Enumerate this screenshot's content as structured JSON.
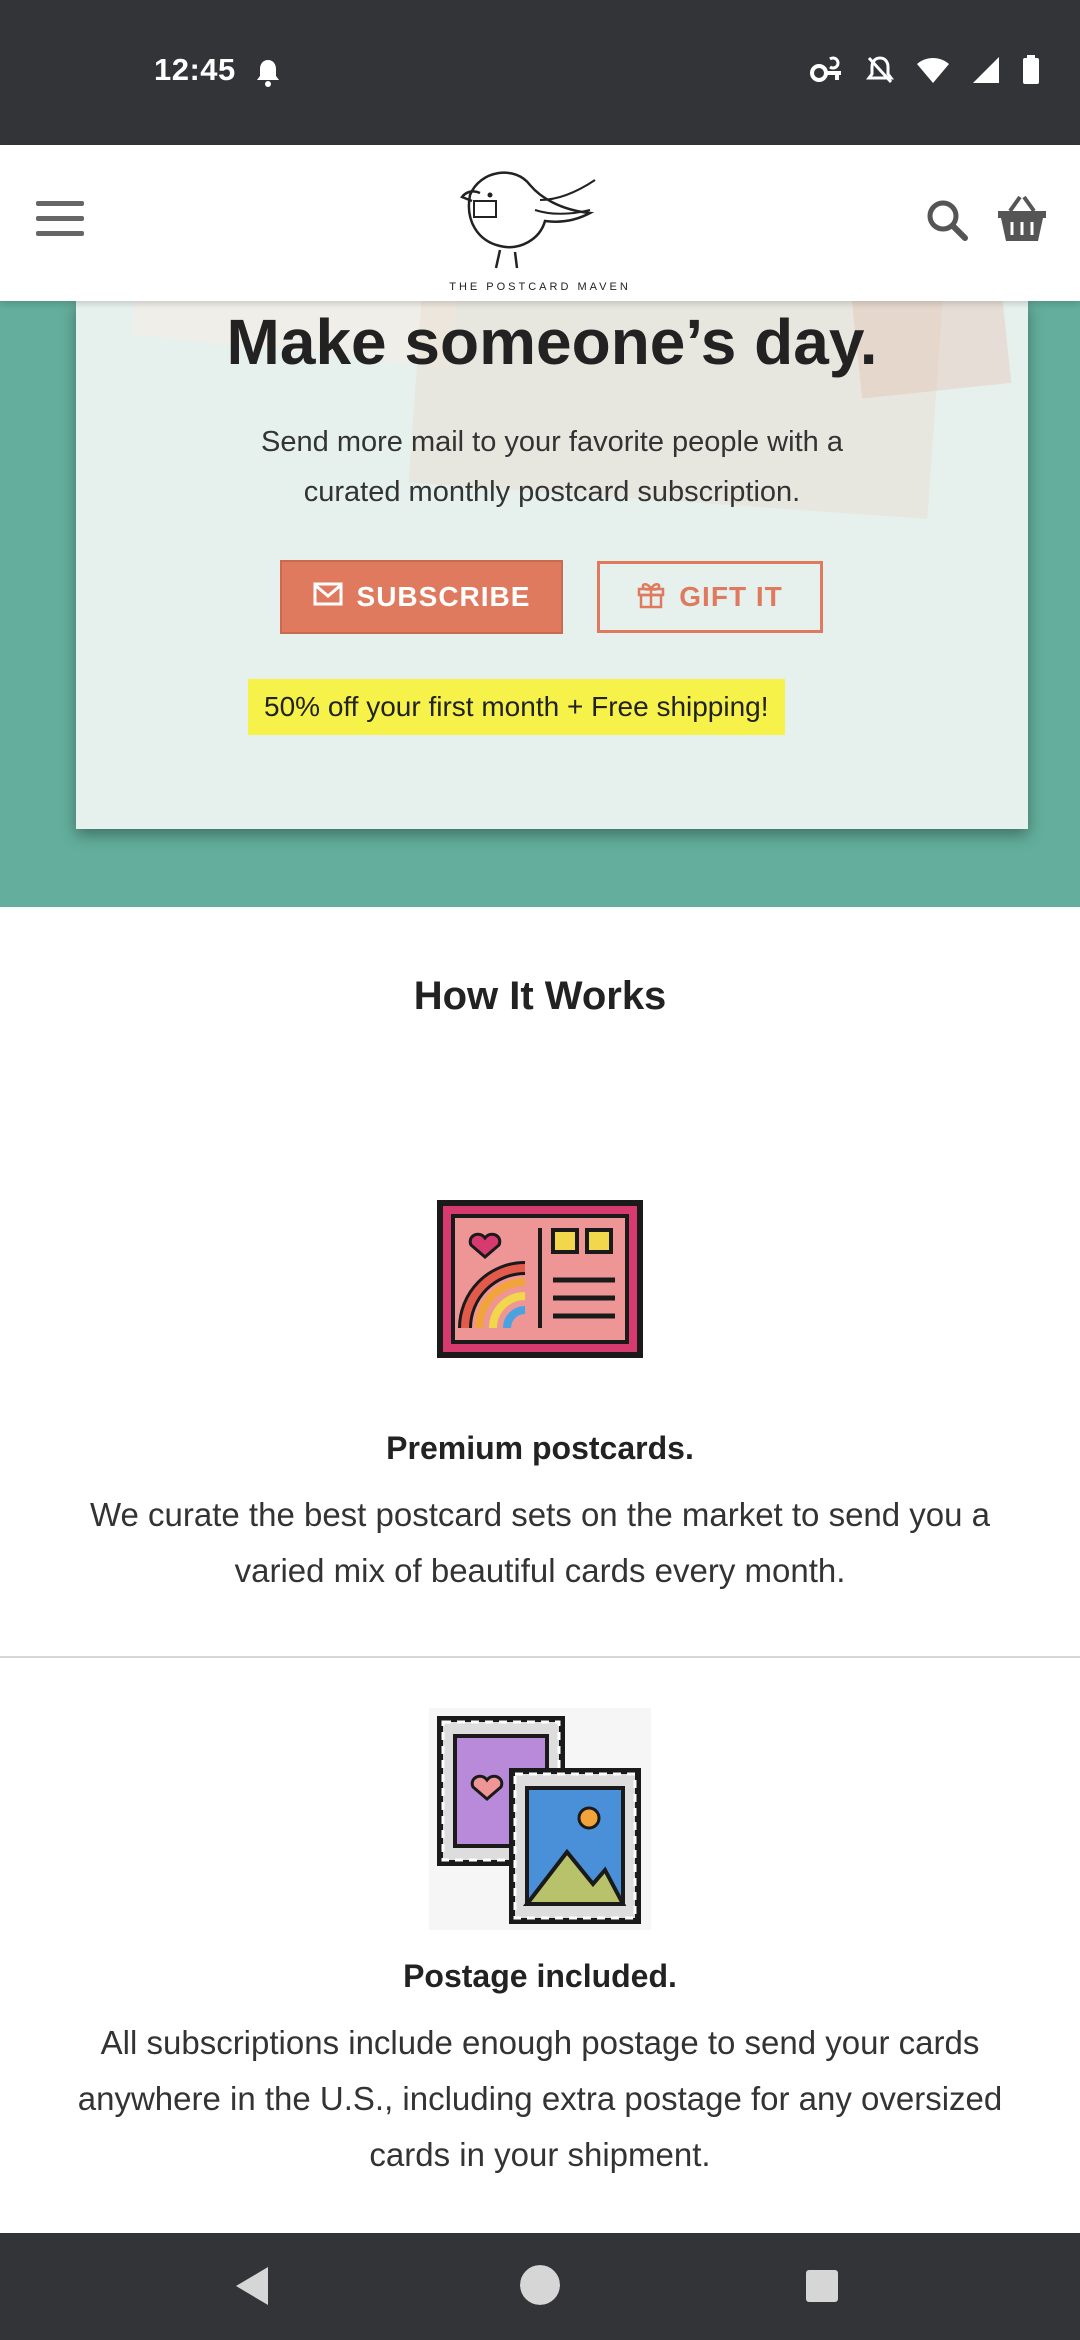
{
  "status_bar": {
    "time": "12:45",
    "icons": [
      "notification-bell-icon",
      "vpn-key-icon",
      "dnd-off-icon",
      "wifi-icon",
      "signal-icon",
      "battery-icon"
    ]
  },
  "header": {
    "logo_text": "THE POSTCARD MAVEN",
    "menu_icon": "hamburger-menu-icon",
    "search_icon": "search-icon",
    "cart_icon": "basket-icon"
  },
  "hero": {
    "title": "Make someone’s day.",
    "subtitle": "Send more mail to your favorite people with a curated monthly postcard subscription.",
    "subscribe_label": "SUBSCRIBE",
    "gift_label": "GIFT IT",
    "promo": "50% off your first month  +  Free shipping!"
  },
  "how_it_works": {
    "title": "How It Works",
    "features": [
      {
        "icon": "postcard-icon",
        "title": "Premium postcards.",
        "text": "We curate the best postcard sets on the market to send you a varied mix of beautiful cards every month."
      },
      {
        "icon": "stamps-icon",
        "title": "Postage included.",
        "text": "All subscriptions include enough postage to send your cards anywhere in the U.S., including extra postage for any oversized cards in your shipment."
      }
    ]
  },
  "colors": {
    "hero_bg": "#63ae9c",
    "hero_card": "#e6f1ee",
    "accent": "#e07a5f",
    "promo_highlight": "#f6f24a",
    "system_bars": "#333438"
  }
}
